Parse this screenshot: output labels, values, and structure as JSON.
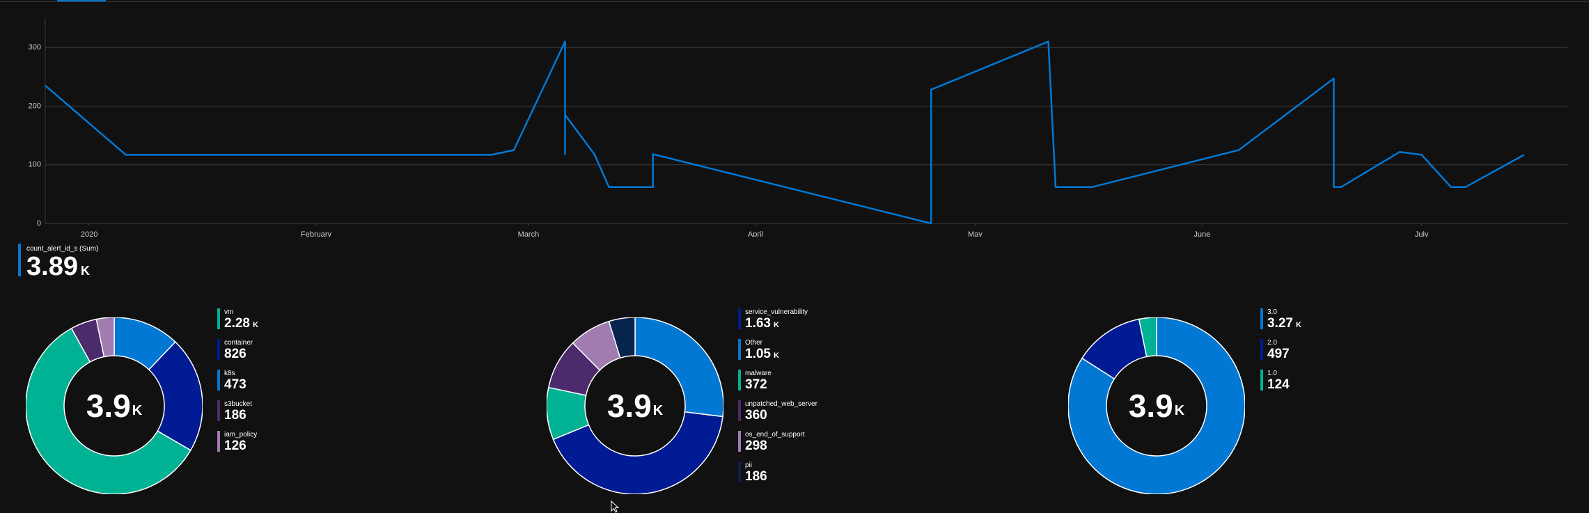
{
  "colors": {
    "background": "#111111",
    "line": "#0078d4",
    "gridline": "#3c3c3c",
    "axis_text": "#cccccc",
    "teal": "#00b294",
    "navy": "#001b94",
    "blue": "#0078d4",
    "purple": "#4c2a6b",
    "lavender": "#a07cb0",
    "dark_navy": "#07234e",
    "separator": "#ffffff"
  },
  "chart_data": [
    {
      "type": "line",
      "x_type": "date",
      "title": "",
      "xlabel": "",
      "ylabel": "",
      "ylim": [
        0,
        350
      ],
      "xlim": [
        "2019-12-26",
        "2020-07-21"
      ],
      "y_ticks": [
        0,
        100,
        200,
        300
      ],
      "x_tick_labels": [
        {
          "date": "2020-01-01",
          "label": "2020"
        },
        {
          "date": "2020-02-01",
          "label": "February"
        },
        {
          "date": "2020-03-01",
          "label": "March"
        },
        {
          "date": "2020-04-01",
          "label": "April"
        },
        {
          "date": "2020-05-01",
          "label": "May"
        },
        {
          "date": "2020-06-01",
          "label": "June"
        },
        {
          "date": "2020-07-01",
          "label": "July"
        }
      ],
      "grid": true,
      "series": [
        {
          "name": "count_alert_id_s (Sum)",
          "points": [
            [
              "2019-12-26",
              235
            ],
            [
              "2020-01-06",
              117
            ],
            [
              "2020-02-25",
              117
            ],
            [
              "2020-02-28",
              125
            ],
            [
              "2020-03-06",
              310
            ],
            [
              "2020-03-06",
              118
            ],
            [
              "2020-03-06",
              185
            ],
            [
              "2020-03-10",
              118
            ],
            [
              "2020-03-12",
              62
            ],
            [
              "2020-03-18",
              62
            ],
            [
              "2020-03-18",
              118
            ],
            [
              "2020-04-25",
              0
            ],
            [
              "2020-04-25",
              228
            ],
            [
              "2020-05-11",
              310
            ],
            [
              "2020-05-12",
              62
            ],
            [
              "2020-05-17",
              62
            ],
            [
              "2020-06-06",
              125
            ],
            [
              "2020-06-19",
              247
            ],
            [
              "2020-06-19",
              62
            ],
            [
              "2020-06-20",
              62
            ],
            [
              "2020-06-28",
              122
            ],
            [
              "2020-07-01",
              117
            ],
            [
              "2020-07-05",
              62
            ],
            [
              "2020-07-07",
              62
            ],
            [
              "2020-07-15",
              117
            ]
          ]
        }
      ]
    },
    {
      "type": "pie",
      "donut": true,
      "center_value": "3.9",
      "center_unit": "K",
      "slices": [
        {
          "label": "vm",
          "value": 2280,
          "display": "2.28",
          "unit": "K",
          "color": "#00b294"
        },
        {
          "label": "container",
          "value": 826,
          "display": "826",
          "unit": "",
          "color": "#001b94"
        },
        {
          "label": "k8s",
          "value": 473,
          "display": "473",
          "unit": "",
          "color": "#0078d4"
        },
        {
          "label": "s3bucket",
          "value": 186,
          "display": "186",
          "unit": "",
          "color": "#4c2a6b"
        },
        {
          "label": "iam_policy",
          "value": 126,
          "display": "126",
          "unit": "",
          "color": "#a07cb0"
        }
      ],
      "draw_order": [
        "k8s",
        "container",
        "vm",
        "s3bucket",
        "iam_policy"
      ]
    },
    {
      "type": "pie",
      "donut": true,
      "center_value": "3.9",
      "center_unit": "K",
      "slices": [
        {
          "label": "service_vulnerability",
          "value": 1630,
          "display": "1.63",
          "unit": "K",
          "color": "#001b94"
        },
        {
          "label": "Other",
          "value": 1050,
          "display": "1.05",
          "unit": "K",
          "color": "#0078d4"
        },
        {
          "label": "malware",
          "value": 372,
          "display": "372",
          "unit": "",
          "color": "#00b294"
        },
        {
          "label": "unpatched_web_server",
          "value": 360,
          "display": "360",
          "unit": "",
          "color": "#4c2a6b"
        },
        {
          "label": "os_end_of_support",
          "value": 298,
          "display": "298",
          "unit": "",
          "color": "#a07cb0"
        },
        {
          "label": "pii",
          "value": 186,
          "display": "186",
          "unit": "",
          "color": "#07234e"
        }
      ],
      "draw_order": [
        "Other",
        "service_vulnerability",
        "malware",
        "unpatched_web_server",
        "os_end_of_support",
        "pii"
      ]
    },
    {
      "type": "pie",
      "donut": true,
      "center_value": "3.9",
      "center_unit": "K",
      "slices": [
        {
          "label": "3.0",
          "value": 3270,
          "display": "3.27",
          "unit": "K",
          "color": "#0078d4"
        },
        {
          "label": "2.0",
          "value": 497,
          "display": "497",
          "unit": "",
          "color": "#001b94"
        },
        {
          "label": "1.0",
          "value": 124,
          "display": "124",
          "unit": "",
          "color": "#00b294"
        }
      ],
      "draw_order": [
        "3.0",
        "2.0",
        "1.0"
      ]
    }
  ],
  "summary": {
    "label": "count_alert_id_s (Sum)",
    "value": "3.89",
    "unit": "K"
  },
  "icons": {
    "cursor": "mouse-pointer-icon"
  }
}
